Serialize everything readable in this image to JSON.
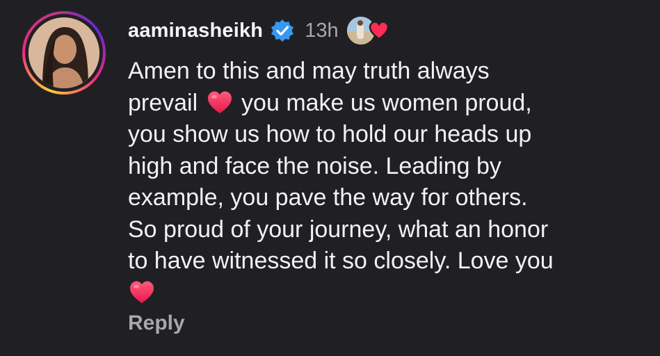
{
  "comment": {
    "username": "aaminasheikh",
    "verified_icon": "verified-badge-icon",
    "timestamp": "13h",
    "lines": [
      {
        "before": "Amen to this and may truth always",
        "after": ""
      },
      {
        "before": "prevail ",
        "after": " you make us women proud,"
      },
      {
        "before": "you show us how to hold our heads up",
        "after": ""
      },
      {
        "before": "high and face the noise. Leading by",
        "after": ""
      },
      {
        "before": "example, you pave the way for others.",
        "after": ""
      },
      {
        "before": "So proud of your journey,  what an honor",
        "after": ""
      },
      {
        "before": "to have witnessed it so closely. Love you",
        "after": ""
      }
    ],
    "heart_emoji": "heart-emoji-icon",
    "reply_label": "Reply"
  },
  "colors": {
    "background": "#202024",
    "text": "#f2f2f2",
    "muted": "#a8a8a8",
    "verified": "#3897f0",
    "heart": "#ff3b6b"
  }
}
